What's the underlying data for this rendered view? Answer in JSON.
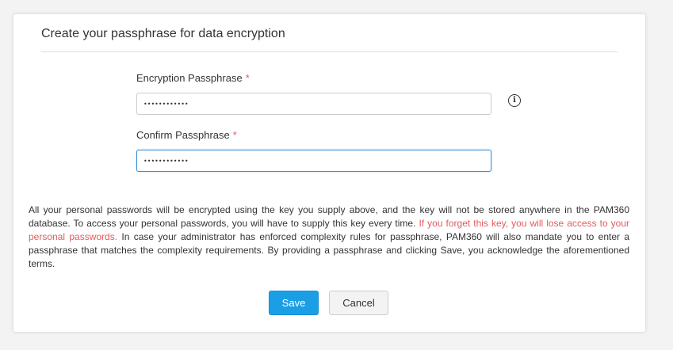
{
  "form": {
    "title": "Create your passphrase for data encryption",
    "passphrase_label": "Encryption Passphrase",
    "passphrase_value": "••••••••••••",
    "confirm_label": "Confirm Passphrase",
    "confirm_value": "••••••••••••",
    "required_marker": "*",
    "info_icon": "i"
  },
  "description": {
    "text_before": "All your personal passwords will be encrypted using the key you supply above, and the key will not be stored anywhere in the PAM360 database. To access your personal passwords, you will have to supply this key every time. ",
    "warning": "If you forget this key, you will lose access to your personal passwords.",
    "text_after": " In case your administrator has enforced complexity rules for passphrase, PAM360 will also mandate you to enter a passphrase that matches the complexity requirements. By providing a passphrase and clicking Save, you acknowledge the aforementioned terms."
  },
  "actions": {
    "save_label": "Save",
    "cancel_label": "Cancel"
  },
  "colors": {
    "primary": "#1a9ee6",
    "warning": "#e25c5c",
    "focus_border": "#3b8fd9"
  }
}
